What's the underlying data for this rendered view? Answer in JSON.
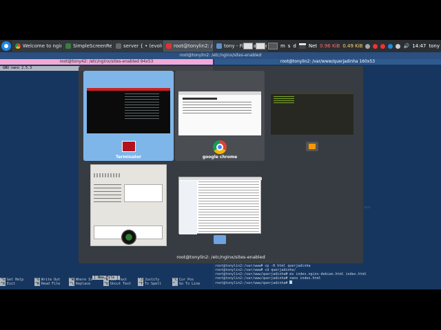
{
  "taskbar": {
    "tasks": [
      {
        "label": "Welcome to ngin...",
        "icon": "chrome-icon"
      },
      {
        "label": "SimpleScreenRec...",
        "icon": "screen-recorder-icon"
      },
      {
        "label": "server { • (evolu...",
        "icon": "terminal-icon"
      },
      {
        "label": "root@tonylin2: /e...",
        "icon": "terminator-icon"
      },
      {
        "label": "tony - File Manager",
        "icon": "folder-icon"
      }
    ],
    "tray": {
      "m_label": "m",
      "s_label": "s",
      "d_label": "d",
      "net_label": "Net",
      "down_speed": "0.96 KiB",
      "up_speed": "0.49 KiB",
      "time": "14:47",
      "user": "tony"
    }
  },
  "terminals": {
    "main_title": "root@tonylin2: /etc/nginx/sites-enabled",
    "left_title": "root@tony42: /etc/nginx/sites-enabled 94x53",
    "right_title": "root@tonylin2: /var/www/querjadinha 160x53",
    "nano_header": "GNU nano 2.5.3",
    "nano_status": "[ New File ]",
    "faint_fragment": "alled and",
    "right_lines": [
      "root@tonylin2:/var/www/html# cd ..",
      "root@tonylin2:/var/www# cp -R html querjadinha",
      "root@tonylin2:/var/www# cd querjadinha/",
      "root@tonylin2:/var/www/querjadinha# mv index.nginx-debian.html index.html",
      "root@tonylin2:/var/www/querjadinha# nano index.html",
      "root@tonylin2:/var/www/querjadinha# "
    ],
    "nano_keys": [
      [
        {
          "k": "^G",
          "t": "Get Help"
        },
        {
          "k": "^O",
          "t": "Write Out"
        },
        {
          "k": "^W",
          "t": "Where Is"
        },
        {
          "k": "^K",
          "t": "Cut Text"
        },
        {
          "k": "^J",
          "t": "Justify"
        },
        {
          "k": "^C",
          "t": "Cur Pos"
        }
      ],
      [
        {
          "k": "^X",
          "t": "Exit"
        },
        {
          "k": "^R",
          "t": "Read File"
        },
        {
          "k": "^\\",
          "t": "Replace"
        },
        {
          "k": "^U",
          "t": "Uncut Text"
        },
        {
          "k": "^T",
          "t": "To Spell"
        },
        {
          "k": "^_",
          "t": "Go To Line"
        }
      ]
    ]
  },
  "switcher": {
    "items": [
      {
        "label": "Terminator",
        "icon": "terminator-icon",
        "selected": true
      },
      {
        "label": "google chrome",
        "icon": "chrome-icon",
        "selected": false
      },
      {
        "label": "",
        "icon": "sublime-text-icon",
        "selected": false
      },
      {
        "label": "",
        "icon": "screen-recorder-icon",
        "selected": false
      },
      {
        "label": "",
        "icon": "file-manager-icon",
        "selected": false
      }
    ],
    "caption": "root@tonylin2: /etc/nginx/sites-enabled"
  },
  "colors": {
    "terminal_bg": "#17365f",
    "selected_thumb": "#7fb6ea",
    "taskbar_bg": "#2b2f33",
    "title_pink": "#f2a9d7"
  }
}
